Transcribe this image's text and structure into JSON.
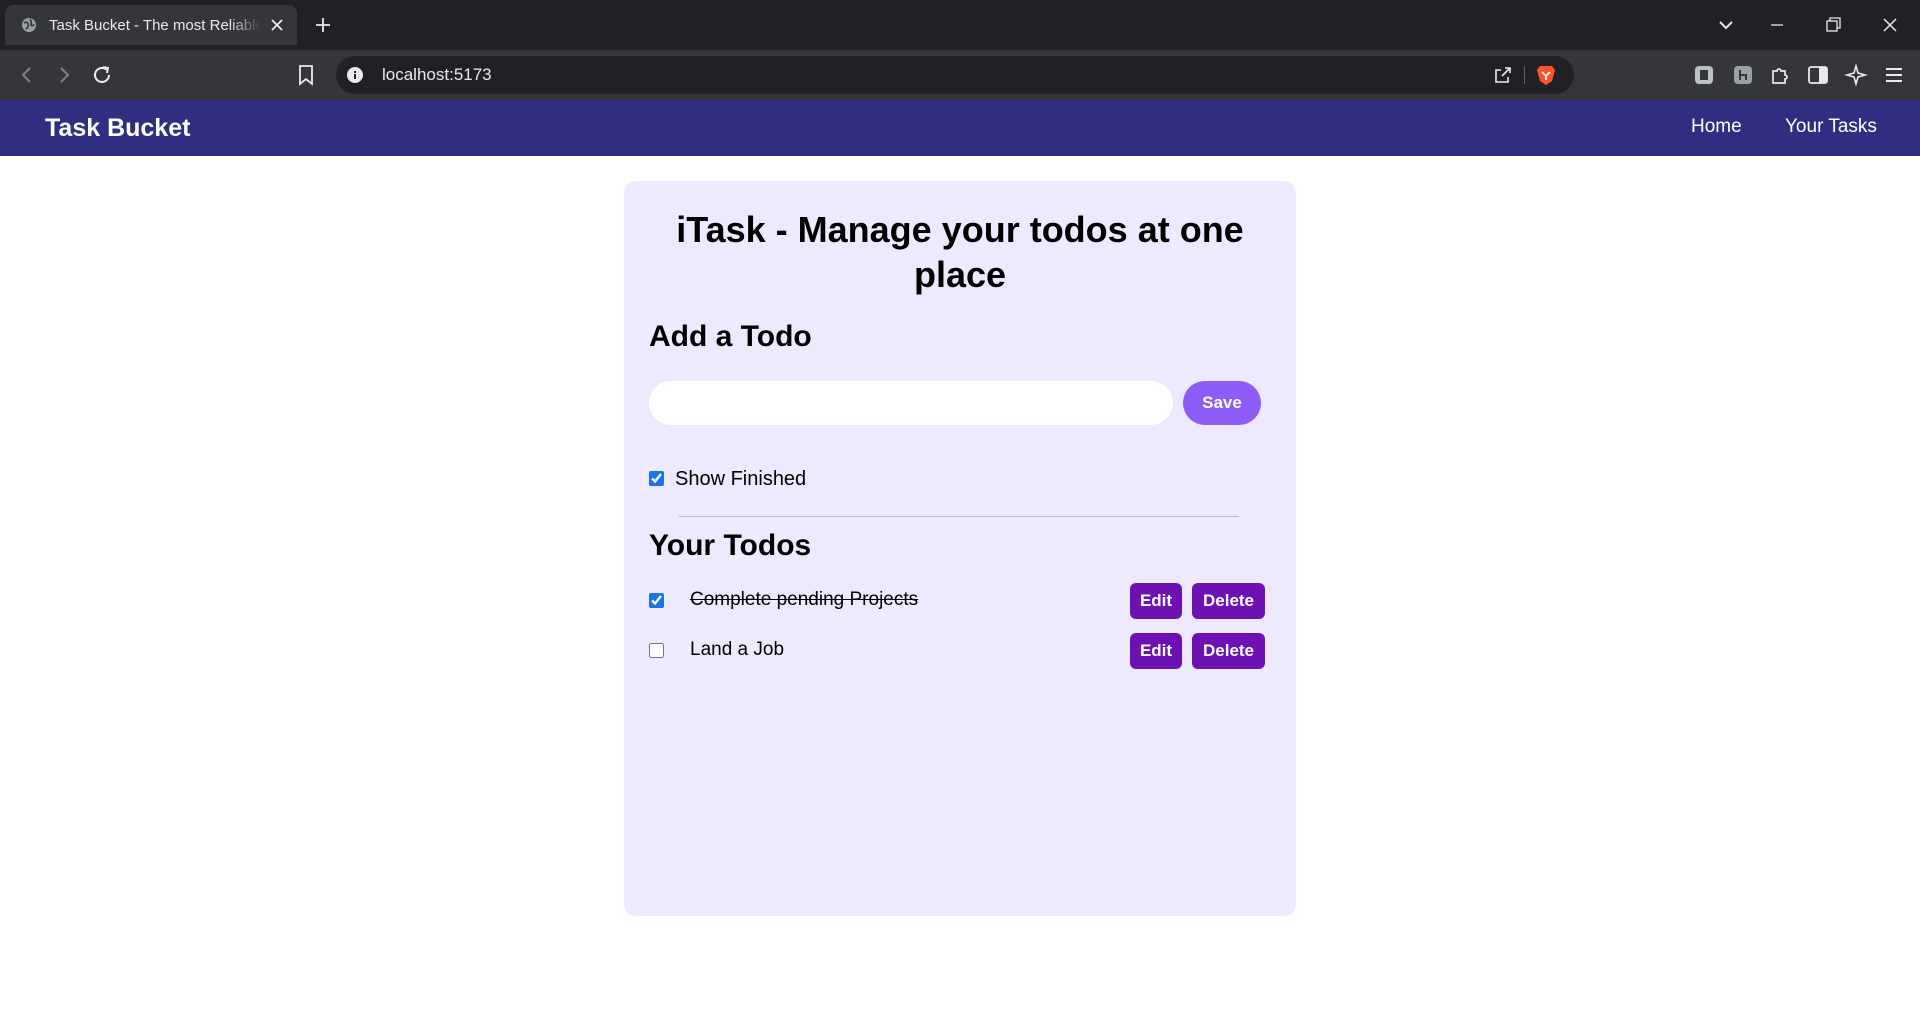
{
  "browser": {
    "tab_title": "Task Bucket - The most Reliable Task Manager",
    "url": "localhost:5173"
  },
  "app": {
    "brand": "Task Bucket",
    "nav": [
      {
        "label": "Home"
      },
      {
        "label": "Your Tasks"
      }
    ],
    "heading": "iTask - Manage your todos at one place",
    "add_title": "Add a Todo",
    "input_value": "",
    "save_label": "Save",
    "show_finished": {
      "label": "Show Finished",
      "checked": true
    },
    "todos_title": "Your Todos",
    "todos": [
      {
        "text": "Complete pending Projects",
        "done": true,
        "edit_label": "Edit",
        "delete_label": "Delete"
      },
      {
        "text": "Land a Job",
        "done": false,
        "edit_label": "Edit",
        "delete_label": "Delete"
      }
    ]
  }
}
